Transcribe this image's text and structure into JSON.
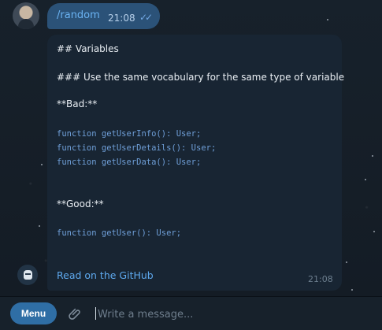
{
  "chat": {
    "outgoing": {
      "text": "/random",
      "time": "21:08"
    },
    "incoming": {
      "lines": [
        "## Variables",
        "### Use the same vocabulary for the same type of variable",
        "**Bad:**",
        "**Good:**"
      ],
      "bad_code": [
        "function getUserInfo(): User;",
        "function getUserDetails(): User;",
        "function getUserData(): User;"
      ],
      "good_code": [
        "function getUser(): User;"
      ],
      "link": "Read on the GitHub",
      "time": "21:08"
    }
  },
  "composer": {
    "menu_label": "Menu",
    "placeholder": "Write a message..."
  },
  "icons": {
    "read": "double-check-icon",
    "attach": "paperclip-icon",
    "bot": "robot-avatar-icon"
  },
  "colors": {
    "background": "#17212b",
    "bubble_out": "#2b5278",
    "bubble_in": "#182533",
    "link": "#5ea9ee",
    "code": "#6f9fd8",
    "menu_button": "#2f6ea5"
  }
}
